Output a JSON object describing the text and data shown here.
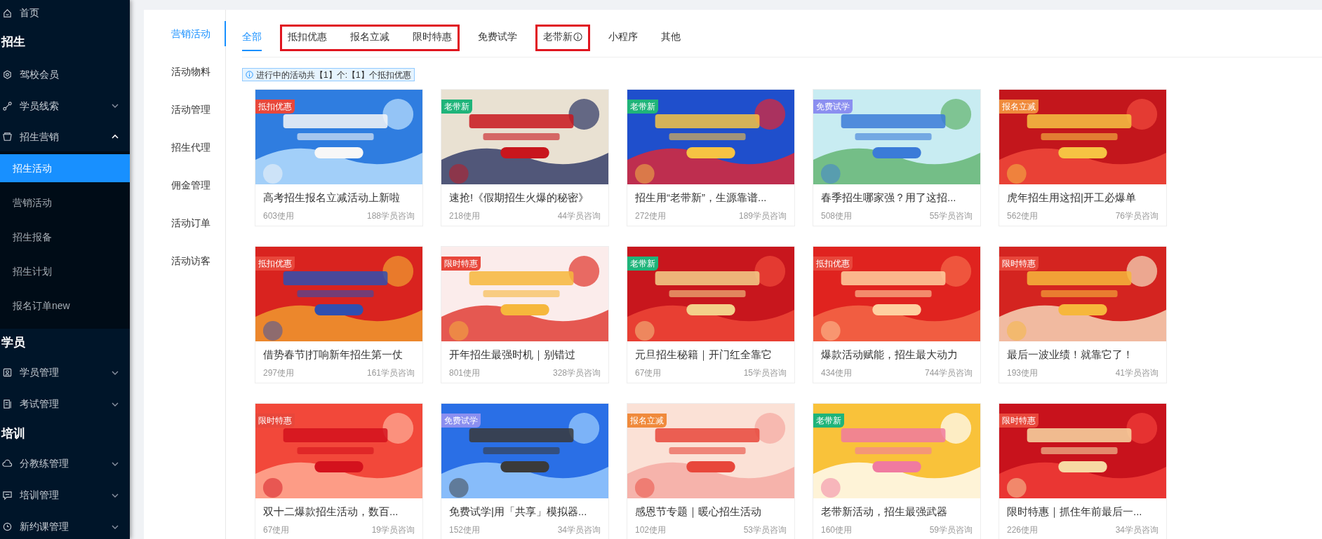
{
  "sidebar": {
    "groups": [
      {
        "items": [
          {
            "label": "首页"
          }
        ]
      },
      {
        "heading": "招生",
        "items": [
          {
            "label": "驾校会员"
          },
          {
            "label": "学员线索",
            "expanded": false
          },
          {
            "label": "招生营销",
            "expanded": true,
            "children": [
              {
                "label": "招生活动",
                "selected": true
              },
              {
                "label": "营销活动",
                "selected": false
              },
              {
                "label": "招生报备",
                "selected": false
              },
              {
                "label": "招生计划",
                "selected": false
              },
              {
                "label": "报名订单new",
                "selected": false
              }
            ]
          }
        ]
      },
      {
        "heading": "学员",
        "items": [
          {
            "label": "学员管理",
            "expanded": false
          },
          {
            "label": "考试管理",
            "expanded": false
          }
        ]
      },
      {
        "heading": "培训",
        "items": [
          {
            "label": "分教练管理",
            "expanded": false
          },
          {
            "label": "培训管理",
            "expanded": false
          },
          {
            "label": "新约课管理",
            "expanded": false
          }
        ]
      }
    ]
  },
  "subnav": [
    {
      "label": "营销活动",
      "selected": true
    },
    {
      "label": "活动物料",
      "selected": false
    },
    {
      "label": "活动管理",
      "selected": false
    },
    {
      "label": "招生代理",
      "selected": false
    },
    {
      "label": "佣金管理",
      "selected": false
    },
    {
      "label": "活动订单",
      "selected": false
    },
    {
      "label": "活动访客",
      "selected": false
    }
  ],
  "tab_groups": [
    {
      "outlined": false,
      "tabs": [
        {
          "label": "全部",
          "selected": true,
          "info": false
        }
      ]
    },
    {
      "outlined": true,
      "tabs": [
        {
          "label": "抵扣优惠",
          "selected": false,
          "info": false
        },
        {
          "label": "报名立减",
          "selected": false,
          "info": false
        },
        {
          "label": "限时特惠",
          "selected": false,
          "info": false
        }
      ]
    },
    {
      "outlined": false,
      "tabs": [
        {
          "label": "免费试学",
          "selected": false,
          "info": false
        }
      ]
    },
    {
      "outlined": true,
      "tabs": [
        {
          "label": "老带新",
          "selected": false,
          "info": true
        }
      ]
    },
    {
      "outlined": false,
      "tabs": [
        {
          "label": "小程序",
          "selected": false,
          "info": false
        },
        {
          "label": "其他",
          "selected": false,
          "info": false
        }
      ]
    }
  ],
  "notice": "进行中的活动共【1】个:【1】个抵扣优惠",
  "cards": [
    {
      "tag": "抵扣优惠",
      "color": "#e8473b",
      "title": "高考招生报名立减活动上新啦",
      "uses": "603使用",
      "consults": "188学员咨询"
    },
    {
      "tag": "老带新",
      "color": "#1fb47a",
      "title": "速抢!《假期招生火爆的秘密》",
      "uses": "218使用",
      "consults": "44学员咨询"
    },
    {
      "tag": "老带新",
      "color": "#1fb47a",
      "title": "招生用“老带新”，生源靠谱...",
      "uses": "272使用",
      "consults": "189学员咨询"
    },
    {
      "tag": "免费试学",
      "color": "#8b8ff0",
      "title": "春季招生哪家强？用了这招...",
      "uses": "508使用",
      "consults": "55学员咨询"
    },
    {
      "tag": "报名立减",
      "color": "#f08a3c",
      "title": "虎年招生用这招|开工必爆单",
      "uses": "562使用",
      "consults": "76学员咨询"
    },
    {
      "tag": "抵扣优惠",
      "color": "#e8473b",
      "title": "借势春节|打响新年招生第一仗",
      "uses": "297使用",
      "consults": "161学员咨询"
    },
    {
      "tag": "限时特惠",
      "color": "#e8473b",
      "title": "开年招生最强时机｜别错过",
      "uses": "801使用",
      "consults": "328学员咨询"
    },
    {
      "tag": "老带新",
      "color": "#1fb47a",
      "title": "元旦招生秘籍｜开门红全靠它",
      "uses": "67使用",
      "consults": "15学员咨询"
    },
    {
      "tag": "抵扣优惠",
      "color": "#e8473b",
      "title": "爆款活动赋能，招生最大动力",
      "uses": "434使用",
      "consults": "744学员咨询"
    },
    {
      "tag": "限时特惠",
      "color": "#e8473b",
      "title": "最后一波业绩！就靠它了！",
      "uses": "193使用",
      "consults": "41学员咨询"
    },
    {
      "tag": "限时特惠",
      "color": "#e8473b",
      "title": "双十二爆款招生活动，数百...",
      "uses": "67使用",
      "consults": "19学员咨询"
    },
    {
      "tag": "免费试学",
      "color": "#8b8ff0",
      "title": "免费试学|用「共享」模拟器...",
      "uses": "152使用",
      "consults": "34学员咨询"
    },
    {
      "tag": "报名立减",
      "color": "#f08a3c",
      "title": "感恩节专题｜暖心招生活动",
      "uses": "102使用",
      "consults": "53学员咨询"
    },
    {
      "tag": "老带新",
      "color": "#1fb47a",
      "title": "老带新活动，招生最强武器",
      "uses": "160使用",
      "consults": "59学员咨询"
    },
    {
      "tag": "限时特惠",
      "color": "#e8473b",
      "title": "限时特惠｜抓住年前最后一...",
      "uses": "226使用",
      "consults": "34学员咨询"
    }
  ]
}
